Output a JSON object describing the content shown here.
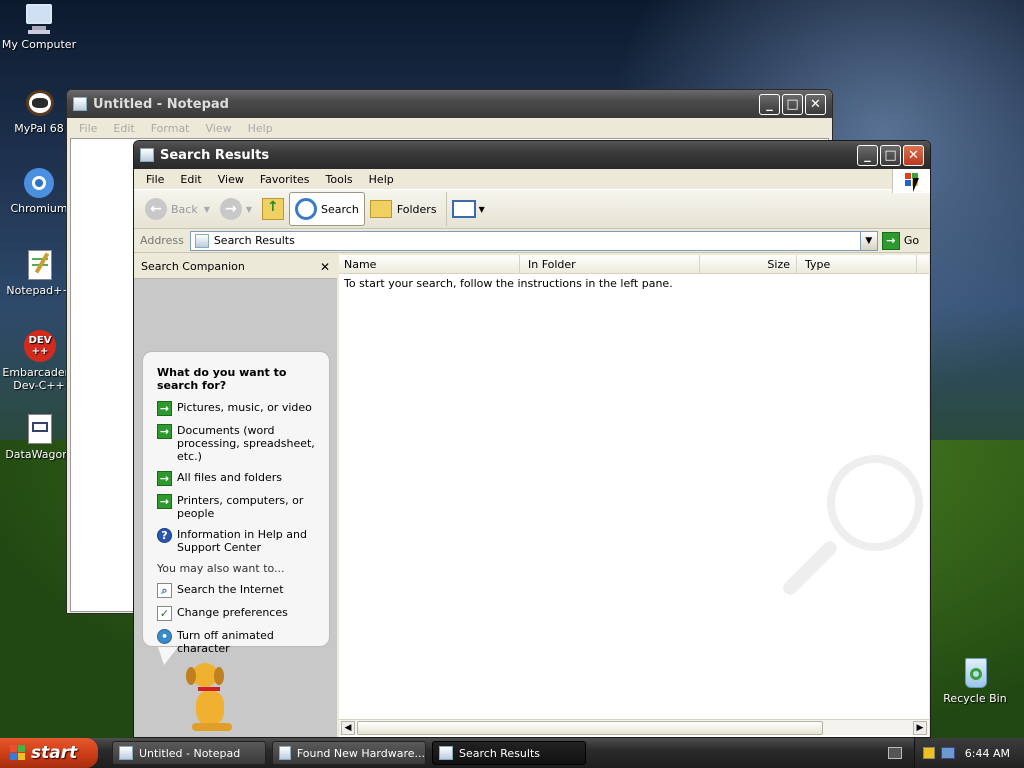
{
  "desktop": {
    "icons": [
      {
        "label": "My Computer",
        "icon": "my-computer-icon"
      },
      {
        "label": "MyPal 68",
        "icon": "mypal-icon"
      },
      {
        "label": "Chromium",
        "icon": "chromium-icon"
      },
      {
        "label": "Notepad++",
        "icon": "notepad-plus-plus-icon"
      },
      {
        "label": "Embarcadero Dev-C++",
        "icon": "dev-cpp-icon"
      },
      {
        "label": "DataWagon.",
        "icon": "datawagon-icon"
      },
      {
        "label": "Recycle Bin",
        "icon": "recycle-bin-icon"
      }
    ],
    "devcpp_badge": "DEV\n++"
  },
  "notepad": {
    "title": "Untitled - Notepad",
    "menu": [
      "File",
      "Edit",
      "Format",
      "View",
      "Help"
    ]
  },
  "search_window": {
    "title": "Search Results",
    "menu": [
      "File",
      "Edit",
      "View",
      "Favorites",
      "Tools",
      "Help"
    ],
    "toolbar": {
      "back": "Back",
      "search": "Search",
      "folders": "Folders"
    },
    "address": {
      "label": "Address",
      "value": "Search Results",
      "go": "Go"
    },
    "companion": {
      "title": "Search Companion",
      "question": "What do you want to search for?",
      "options": [
        "Pictures, music, or video",
        "Documents (word processing, spreadsheet, etc.)",
        "All files and folders",
        "Printers, computers, or people",
        "Information in Help and Support Center"
      ],
      "also_label": "You may also want to...",
      "also": [
        "Search the Internet",
        "Change preferences",
        "Turn off animated character"
      ]
    },
    "columns": [
      "Name",
      "In Folder",
      "Size",
      "Type"
    ],
    "results_message": "To start your search, follow the instructions in the left pane."
  },
  "taskbar": {
    "start": "start",
    "tasks": [
      "Untitled - Notepad",
      "Found New Hardware...",
      "Search Results"
    ],
    "clock": "6:44 AM"
  },
  "colors": {
    "accent": "#3a3a3a",
    "start": "#c83a14",
    "go": "#2c9a2c"
  }
}
